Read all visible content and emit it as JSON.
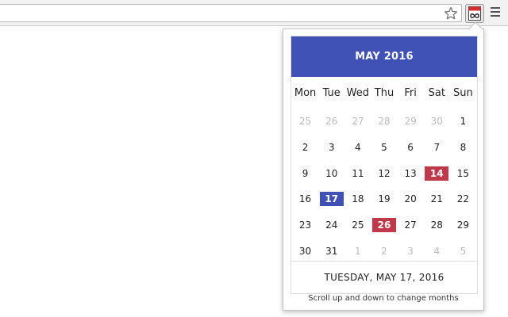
{
  "toolbar": {
    "icons": [
      "star-icon",
      "calendar-extension-icon",
      "menu-icon"
    ]
  },
  "calendar": {
    "title": "MAY 2016",
    "weekdays": [
      "Mon",
      "Tue",
      "Wed",
      "Thu",
      "Fri",
      "Sat",
      "Sun"
    ],
    "days": [
      {
        "label": "25",
        "state": "other"
      },
      {
        "label": "26",
        "state": "other"
      },
      {
        "label": "27",
        "state": "other"
      },
      {
        "label": "28",
        "state": "other"
      },
      {
        "label": "29",
        "state": "other"
      },
      {
        "label": "30",
        "state": "other"
      },
      {
        "label": "1",
        "state": "normal"
      },
      {
        "label": "2",
        "state": "normal"
      },
      {
        "label": "3",
        "state": "normal"
      },
      {
        "label": "4",
        "state": "normal"
      },
      {
        "label": "5",
        "state": "normal"
      },
      {
        "label": "6",
        "state": "normal"
      },
      {
        "label": "7",
        "state": "normal"
      },
      {
        "label": "8",
        "state": "normal"
      },
      {
        "label": "9",
        "state": "normal"
      },
      {
        "label": "10",
        "state": "normal"
      },
      {
        "label": "11",
        "state": "normal"
      },
      {
        "label": "12",
        "state": "normal"
      },
      {
        "label": "13",
        "state": "normal"
      },
      {
        "label": "14",
        "state": "holiday"
      },
      {
        "label": "15",
        "state": "normal"
      },
      {
        "label": "16",
        "state": "normal"
      },
      {
        "label": "17",
        "state": "selected"
      },
      {
        "label": "18",
        "state": "normal"
      },
      {
        "label": "19",
        "state": "normal"
      },
      {
        "label": "20",
        "state": "normal"
      },
      {
        "label": "21",
        "state": "normal"
      },
      {
        "label": "22",
        "state": "normal"
      },
      {
        "label": "23",
        "state": "normal"
      },
      {
        "label": "24",
        "state": "normal"
      },
      {
        "label": "25",
        "state": "normal"
      },
      {
        "label": "26",
        "state": "holiday"
      },
      {
        "label": "27",
        "state": "normal"
      },
      {
        "label": "28",
        "state": "normal"
      },
      {
        "label": "29",
        "state": "normal"
      },
      {
        "label": "30",
        "state": "normal"
      },
      {
        "label": "31",
        "state": "normal"
      },
      {
        "label": "1",
        "state": "other"
      },
      {
        "label": "2",
        "state": "other"
      },
      {
        "label": "3",
        "state": "other"
      },
      {
        "label": "4",
        "state": "other"
      },
      {
        "label": "5",
        "state": "other"
      }
    ],
    "selected_date_text": "TUESDAY, MAY 17, 2016",
    "hint": "Scroll up and down to change months"
  },
  "colors": {
    "header_bg": "#3f51b5",
    "selected_bg": "#3f51b5",
    "highlight_bg": "#c0394b",
    "muted_text": "#bbbbbb"
  }
}
